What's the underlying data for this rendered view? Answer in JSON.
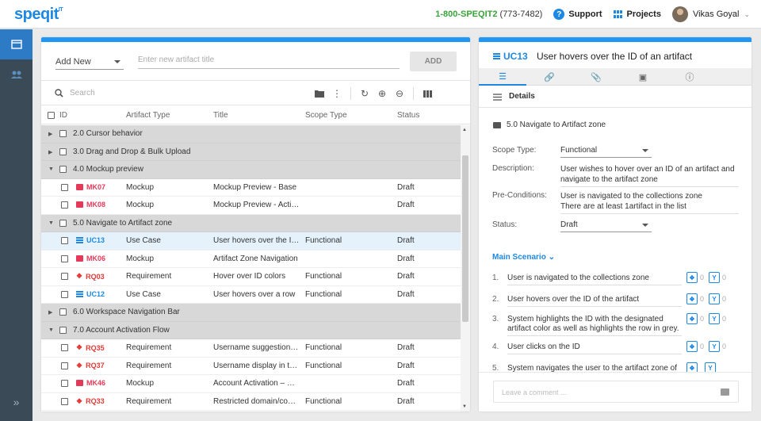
{
  "app": {
    "logo": "speqit",
    "logo_mark": "IT"
  },
  "header": {
    "phone_main": "1-800-SPEQIT2",
    "phone_alt": "(773-7482)",
    "support_label": "Support",
    "projects_label": "Projects",
    "user_name": "Vikas Goyal"
  },
  "toolbar": {
    "add_select": "Add New",
    "title_placeholder": "Enter new artifact title",
    "add_label": "ADD",
    "search_placeholder": "Search"
  },
  "table": {
    "headers": {
      "id": "ID",
      "type": "Artifact Type",
      "title": "Title",
      "scope": "Scope Type",
      "status": "Status"
    },
    "rows": [
      {
        "kind": "group",
        "expanded": false,
        "title": "2.0 Cursor behavior"
      },
      {
        "kind": "group",
        "expanded": false,
        "title": "3.0 Drag and Drop & Bulk Upload"
      },
      {
        "kind": "group",
        "expanded": true,
        "title": "4.0 Mockup preview"
      },
      {
        "kind": "item",
        "icon": "mockup",
        "id": "MK07",
        "type": "Mockup",
        "title": "Mockup Preview - Base",
        "scope": "",
        "status": "Draft"
      },
      {
        "kind": "item",
        "icon": "mockup",
        "id": "MK08",
        "type": "Mockup",
        "title": "Mockup Preview - Activ...",
        "scope": "",
        "status": "Draft"
      },
      {
        "kind": "group",
        "expanded": true,
        "title": "5.0 Navigate to Artifact zone"
      },
      {
        "kind": "item",
        "icon": "usecase",
        "id": "UC13",
        "type": "Use Case",
        "title": "User hovers over the ID ...",
        "scope": "Functional",
        "status": "Draft",
        "selected": true
      },
      {
        "kind": "item",
        "icon": "mockup",
        "id": "MK06",
        "type": "Mockup",
        "title": "Artifact Zone Navigation",
        "scope": "",
        "status": "Draft"
      },
      {
        "kind": "item",
        "icon": "requirement",
        "id": "RQ03",
        "type": "Requirement",
        "title": "Hover over ID colors",
        "scope": "Functional",
        "status": "Draft"
      },
      {
        "kind": "item",
        "icon": "usecase",
        "id": "UC12",
        "type": "Use Case",
        "title": "User hovers over a row",
        "scope": "Functional",
        "status": "Draft"
      },
      {
        "kind": "group",
        "expanded": false,
        "title": "6.0 Workspace Navigation Bar"
      },
      {
        "kind": "group",
        "expanded": true,
        "title": "7.0 Account Activation Flow"
      },
      {
        "kind": "item",
        "icon": "requirement",
        "id": "RQ35",
        "type": "Requirement",
        "title": "Username suggestions ...",
        "scope": "Functional",
        "status": "Draft"
      },
      {
        "kind": "item",
        "icon": "requirement",
        "id": "RQ37",
        "type": "Requirement",
        "title": "Username display in the...",
        "scope": "Functional",
        "status": "Draft"
      },
      {
        "kind": "item",
        "icon": "mockup",
        "id": "MK46",
        "type": "Mockup",
        "title": "Account Activation – Us..",
        "scope": "",
        "status": "Draft"
      },
      {
        "kind": "item",
        "icon": "requirement",
        "id": "RQ33",
        "type": "Requirement",
        "title": "Restricted domain/com...",
        "scope": "Functional",
        "status": "Draft"
      }
    ]
  },
  "detail": {
    "id": "UC13",
    "title": "User hovers over the ID of an artifact",
    "section_title": "Details",
    "folder": "5.0 Navigate to Artifact zone",
    "scope_label": "Scope Type:",
    "scope_value": "Functional",
    "description_label": "Description:",
    "description_value": "User wishes to hover over an ID of an artifact and navigate to the artifact zone",
    "preconditions_label": "Pre-Conditions:",
    "preconditions_line1": "User is navigated to the collections zone",
    "preconditions_line2": "There are at least 1artifact in the list",
    "status_label": "Status:",
    "status_value": "Draft",
    "main_scenario_label": "Main Scenario",
    "steps": [
      {
        "num": "1.",
        "text": "User is navigated to the collections zone",
        "a": "0",
        "b": "0"
      },
      {
        "num": "2.",
        "text": "User hovers over the ID of the artifact",
        "a": "0",
        "b": "0"
      },
      {
        "num": "3.",
        "text": "System highlights the ID with the designated artifact color as well as highlights the row in grey.",
        "a": "0",
        "b": "0"
      },
      {
        "num": "4.",
        "text": "User clicks on the ID",
        "a": "0",
        "b": "0"
      },
      {
        "num": "5.",
        "text": "System navigates the user to the artifact zone of",
        "a": "",
        "b": ""
      }
    ],
    "comment_placeholder": "Leave a comment ..."
  },
  "colors": {
    "accent": "#2196f3",
    "mockup": "#e5395a",
    "requirement": "#e53935",
    "usecase": "#1e88e5",
    "phone": "#3aa33a",
    "nav": "#3b4a57"
  }
}
